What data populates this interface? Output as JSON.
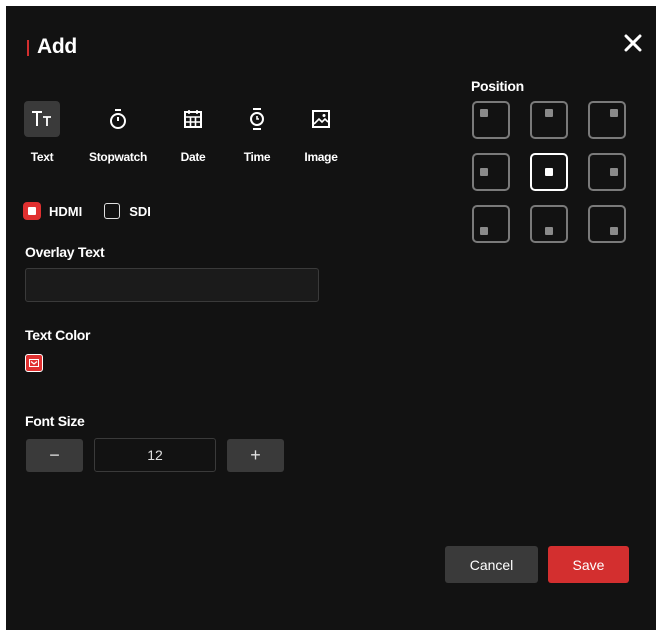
{
  "dialog": {
    "title": "Add",
    "close_icon": "close-icon",
    "accent_color": "#d32f2f"
  },
  "overlay_types": [
    {
      "label": "Text",
      "icon": "text-icon",
      "selected": true
    },
    {
      "label": "Stopwatch",
      "icon": "stopwatch-icon",
      "selected": false
    },
    {
      "label": "Date",
      "icon": "calendar-icon",
      "selected": false
    },
    {
      "label": "Time",
      "icon": "watch-icon",
      "selected": false
    },
    {
      "label": "Image",
      "icon": "image-icon",
      "selected": false
    }
  ],
  "outputs": [
    {
      "label": "HDMI",
      "checked": true
    },
    {
      "label": "SDI",
      "checked": false
    }
  ],
  "overlay_text": {
    "label": "Overlay Text",
    "value": "",
    "placeholder": ""
  },
  "text_color": {
    "label": "Text Color",
    "value": "#e03030"
  },
  "font_size": {
    "label": "Font Size",
    "value": "12",
    "decrement": "−",
    "increment": "+"
  },
  "position": {
    "label": "Position",
    "options": [
      "top-left",
      "top-center",
      "top-right",
      "middle-left",
      "center",
      "middle-right",
      "bottom-left",
      "bottom-center",
      "bottom-right"
    ],
    "selected": "center"
  },
  "buttons": {
    "cancel": "Cancel",
    "save": "Save"
  }
}
